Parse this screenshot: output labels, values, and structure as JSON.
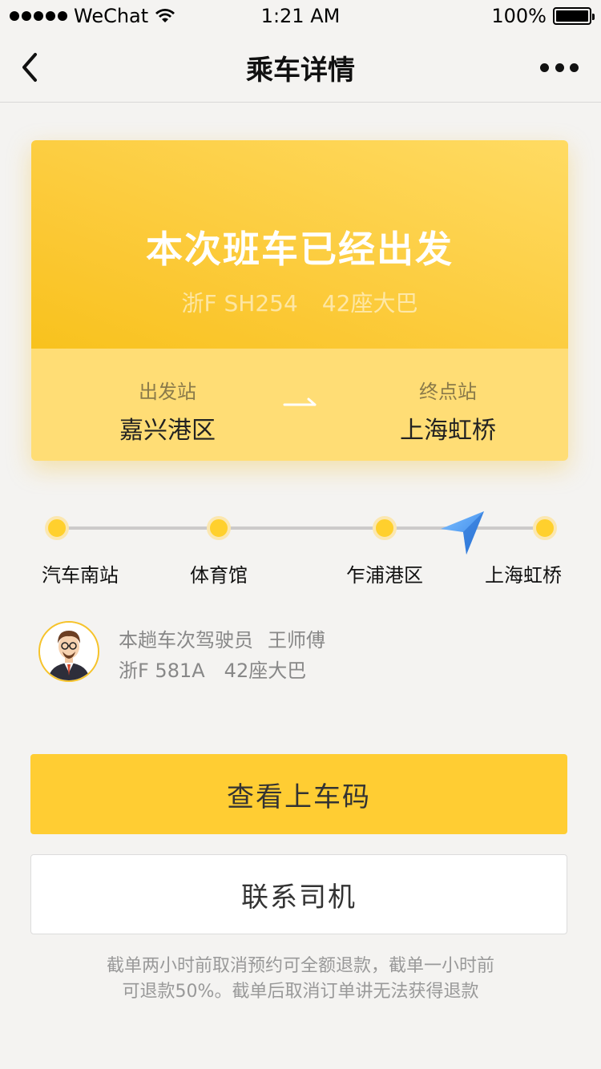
{
  "status_bar": {
    "carrier": "WeChat",
    "time": "1:21 AM",
    "battery_percent": "100%",
    "battery_level": 1.0
  },
  "nav": {
    "title": "乘车详情",
    "back_icon": "chevron-left-icon",
    "more_icon": "more-dots-icon"
  },
  "trip_card": {
    "headline": "本次班车已经出发",
    "plate": "浙F SH254",
    "bus_type": "42座大巴",
    "from_label": "出发站",
    "from_station": "嘉兴港区",
    "to_label": "终点站",
    "to_station": "上海虹桥"
  },
  "route": {
    "stops": [
      "汽车南站",
      "体育馆",
      "乍浦港区",
      "上海虹桥"
    ],
    "current_between": [
      2,
      3
    ]
  },
  "driver": {
    "role_text": "本趟车次驾驶员",
    "name": "王师傅",
    "plate": "浙F 581A",
    "bus_type": "42座大巴"
  },
  "buttons": {
    "primary": "查看上车码",
    "secondary": "联系司机"
  },
  "notice": {
    "line1": "截单两小时前取消预约可全额退款，截单一小时前",
    "line2": "可退款50%。截单后取消订单讲无法获得退款"
  },
  "colors": {
    "accent": "#ffcd33",
    "card_gradient_start": "#ffdb63",
    "card_gradient_end": "#f8c21d",
    "pointer_blue": "#3a8ff0"
  }
}
